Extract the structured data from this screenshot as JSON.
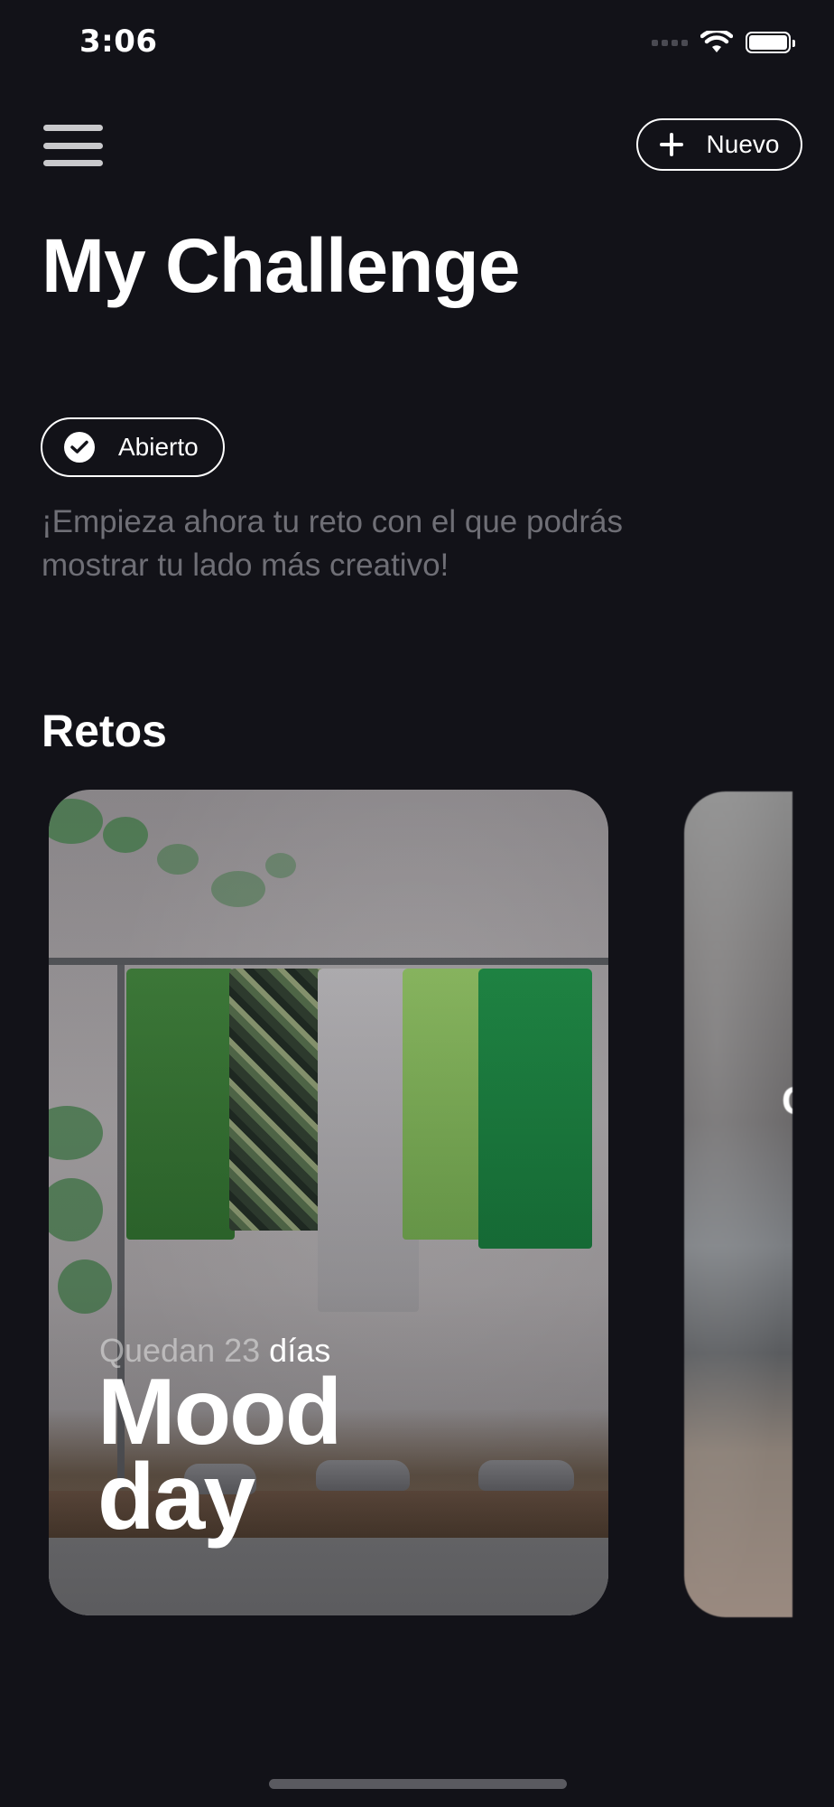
{
  "status_bar": {
    "time": "3:06",
    "icons": [
      "signal-icon",
      "wifi-icon",
      "battery-icon"
    ]
  },
  "header": {
    "menu_icon": "hamburger-menu-icon",
    "new_button_label": "Nuevo",
    "new_button_icon": "plus-icon"
  },
  "title": "My Challenge",
  "status_pill": {
    "label": "Abierto",
    "icon": "check-circle-icon"
  },
  "intro": "¡Empieza ahora tu reto con el que podrás mostrar tu lado más creativo!",
  "section": {
    "title": "Retos"
  },
  "challenges": [
    {
      "remaining_prefix": "Quedan 23",
      "remaining_unit": "días",
      "title": "Mood day"
    },
    {
      "partial_title_letter": "C"
    }
  ],
  "colors": {
    "background": "#121218",
    "text": "#ffffff",
    "muted_text": "#6f6f76",
    "menu_icon": "#c9c9cc"
  }
}
